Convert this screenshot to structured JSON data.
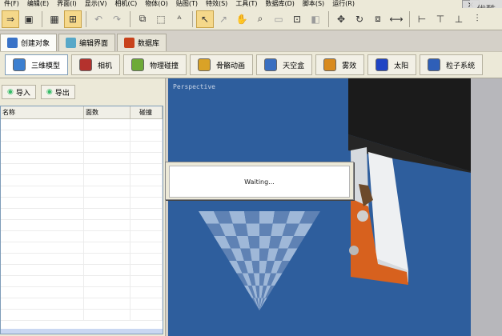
{
  "menubar": {
    "items": [
      "件(F)",
      "编辑(E)",
      "界面(I)",
      "显示(V)",
      "相机(C)",
      "物体(O)",
      "贴图(T)",
      "特效(S)",
      "工具(T)",
      "数据库(D)",
      "脚本(S)",
      "运行(R)"
    ],
    "system_button": "×",
    "logo_text": "优酷"
  },
  "toolbar": {
    "buttons": [
      {
        "name": "arrow-select-icon",
        "glyph": "⇒",
        "active": true
      },
      {
        "name": "save-icon",
        "glyph": "▣",
        "active": false
      },
      {
        "name": "grid-icon",
        "glyph": "▦",
        "active": false
      },
      {
        "name": "snap-grid-icon",
        "glyph": "⊞",
        "active": true
      },
      {
        "name": "undo-icon",
        "glyph": "↶",
        "dim": true
      },
      {
        "name": "redo-icon",
        "glyph": "↷",
        "dim": true
      },
      {
        "name": "copy-icon",
        "glyph": "⧉"
      },
      {
        "name": "select-region-icon",
        "glyph": "⬚"
      },
      {
        "name": "abc-text-icon",
        "glyph": "ᴬ"
      },
      {
        "name": "pointer-icon",
        "glyph": "↖",
        "active": true
      },
      {
        "name": "link-pointer-icon",
        "glyph": "↗",
        "dim": true
      },
      {
        "name": "hand-pan-icon",
        "glyph": "✋"
      },
      {
        "name": "zoom-icon",
        "glyph": "⌕"
      },
      {
        "name": "camera-icon",
        "glyph": "▭",
        "dim": true
      },
      {
        "name": "target-icon",
        "glyph": "⊡"
      },
      {
        "name": "shape-icon",
        "glyph": "◧",
        "dim": true
      },
      {
        "name": "move-icon",
        "glyph": "✥"
      },
      {
        "name": "rotate-icon",
        "glyph": "↻"
      },
      {
        "name": "scale-icon",
        "glyph": "⧈"
      },
      {
        "name": "mirror-icon",
        "glyph": "⟷"
      },
      {
        "name": "align-h-icon",
        "glyph": "⊢"
      },
      {
        "name": "align-v-icon",
        "glyph": "⊤"
      },
      {
        "name": "align-center-icon",
        "glyph": "⊥"
      },
      {
        "name": "distribute-icon",
        "glyph": "⫶"
      }
    ]
  },
  "top_tabs": [
    {
      "label": "创建对象",
      "active": true,
      "color": "#3a73c7"
    },
    {
      "label": "编辑界面",
      "active": false,
      "color": "#58a8c8"
    },
    {
      "label": "数据库",
      "active": false,
      "color": "#c8421c"
    }
  ],
  "object_tabs": [
    {
      "label": "三维模型",
      "active": true,
      "color": "#3c7fd0"
    },
    {
      "label": "相机",
      "active": false,
      "color": "#b4322d"
    },
    {
      "label": "物理碰撞",
      "active": false,
      "color": "#6eaa37"
    },
    {
      "label": "骨骼动画",
      "active": false,
      "color": "#d9a227"
    },
    {
      "label": "天空盒",
      "active": false,
      "color": "#3a6fc0"
    },
    {
      "label": "雾效",
      "active": false,
      "color": "#d88a1d"
    },
    {
      "label": "太阳",
      "active": false,
      "color": "#1f44c4"
    },
    {
      "label": "粒子系统",
      "active": false,
      "color": "#2f5fb8"
    }
  ],
  "left_panel": {
    "import_label": "导入",
    "export_label": "导出",
    "columns": [
      "名称",
      "面数",
      "碰撞"
    ],
    "row_count": 18
  },
  "viewport": {
    "label": "Perspective",
    "background": "#2e5e9d"
  },
  "dialog": {
    "message": "Waiting..."
  }
}
